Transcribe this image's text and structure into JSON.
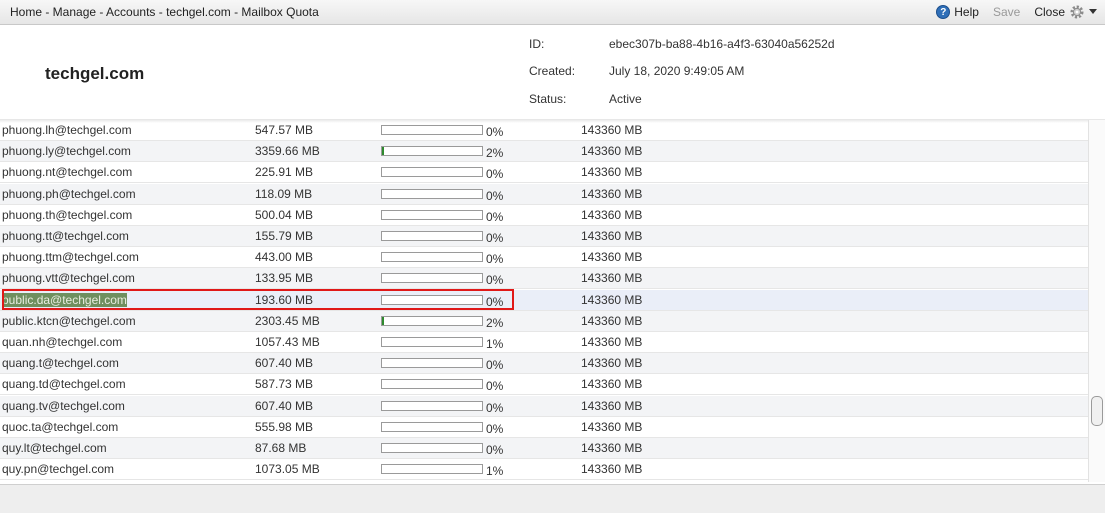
{
  "topbar": {
    "breadcrumb": "Home - Manage - Accounts - techgel.com - Mailbox Quota",
    "help_label": "Help",
    "save_label": "Save",
    "close_label": "Close",
    "help_icon_glyph": "?"
  },
  "header": {
    "account_name": "techgel.com",
    "id_label": "ID:",
    "id_value": "ebec307b-ba88-4b16-a4f3-63040a56252d",
    "created_label": "Created:",
    "created_value": "July 18, 2020 9:49:05 AM",
    "status_label": "Status:",
    "status_value": "Active"
  },
  "rows": [
    {
      "email": "phuong.lh@techgel.com",
      "size": "547.57 MB",
      "usage": 0.4,
      "pct": "0%",
      "quota": "143360 MB"
    },
    {
      "email": "phuong.ly@techgel.com",
      "size": "3359.66 MB",
      "usage": 2.3,
      "pct": "2%",
      "quota": "143360 MB"
    },
    {
      "email": "phuong.nt@techgel.com",
      "size": "225.91 MB",
      "usage": 0.2,
      "pct": "0%",
      "quota": "143360 MB"
    },
    {
      "email": "phuong.ph@techgel.com",
      "size": "118.09 MB",
      "usage": 0.1,
      "pct": "0%",
      "quota": "143360 MB"
    },
    {
      "email": "phuong.th@techgel.com",
      "size": "500.04 MB",
      "usage": 0.3,
      "pct": "0%",
      "quota": "143360 MB"
    },
    {
      "email": "phuong.tt@techgel.com",
      "size": "155.79 MB",
      "usage": 0.1,
      "pct": "0%",
      "quota": "143360 MB"
    },
    {
      "email": "phuong.ttm@techgel.com",
      "size": "443.00 MB",
      "usage": 0.3,
      "pct": "0%",
      "quota": "143360 MB"
    },
    {
      "email": "phuong.vtt@techgel.com",
      "size": "133.95 MB",
      "usage": 0.1,
      "pct": "0%",
      "quota": "143360 MB"
    },
    {
      "email": "public.da@techgel.com",
      "size": "193.60 MB",
      "usage": 0.1,
      "pct": "0%",
      "quota": "143360 MB",
      "selected": true
    },
    {
      "email": "public.ktcn@techgel.com",
      "size": "2303.45 MB",
      "usage": 1.6,
      "pct": "2%",
      "quota": "143360 MB"
    },
    {
      "email": "quan.nh@techgel.com",
      "size": "1057.43 MB",
      "usage": 0.7,
      "pct": "1%",
      "quota": "143360 MB"
    },
    {
      "email": "quang.t@techgel.com",
      "size": "607.40 MB",
      "usage": 0.4,
      "pct": "0%",
      "quota": "143360 MB"
    },
    {
      "email": "quang.td@techgel.com",
      "size": "587.73 MB",
      "usage": 0.4,
      "pct": "0%",
      "quota": "143360 MB"
    },
    {
      "email": "quang.tv@techgel.com",
      "size": "607.40 MB",
      "usage": 0.4,
      "pct": "0%",
      "quota": "143360 MB"
    },
    {
      "email": "quoc.ta@techgel.com",
      "size": "555.98 MB",
      "usage": 0.4,
      "pct": "0%",
      "quota": "143360 MB"
    },
    {
      "email": "quy.lt@techgel.com",
      "size": "87.68 MB",
      "usage": 0.1,
      "pct": "0%",
      "quota": "143360 MB"
    },
    {
      "email": "quy.pn@techgel.com",
      "size": "1073.05 MB",
      "usage": 0.7,
      "pct": "1%",
      "quota": "143360 MB"
    }
  ],
  "colors": {
    "bar_fill": "#2e8a2e",
    "selection_border": "#e01818",
    "help_icon": "#2f6fb8"
  }
}
